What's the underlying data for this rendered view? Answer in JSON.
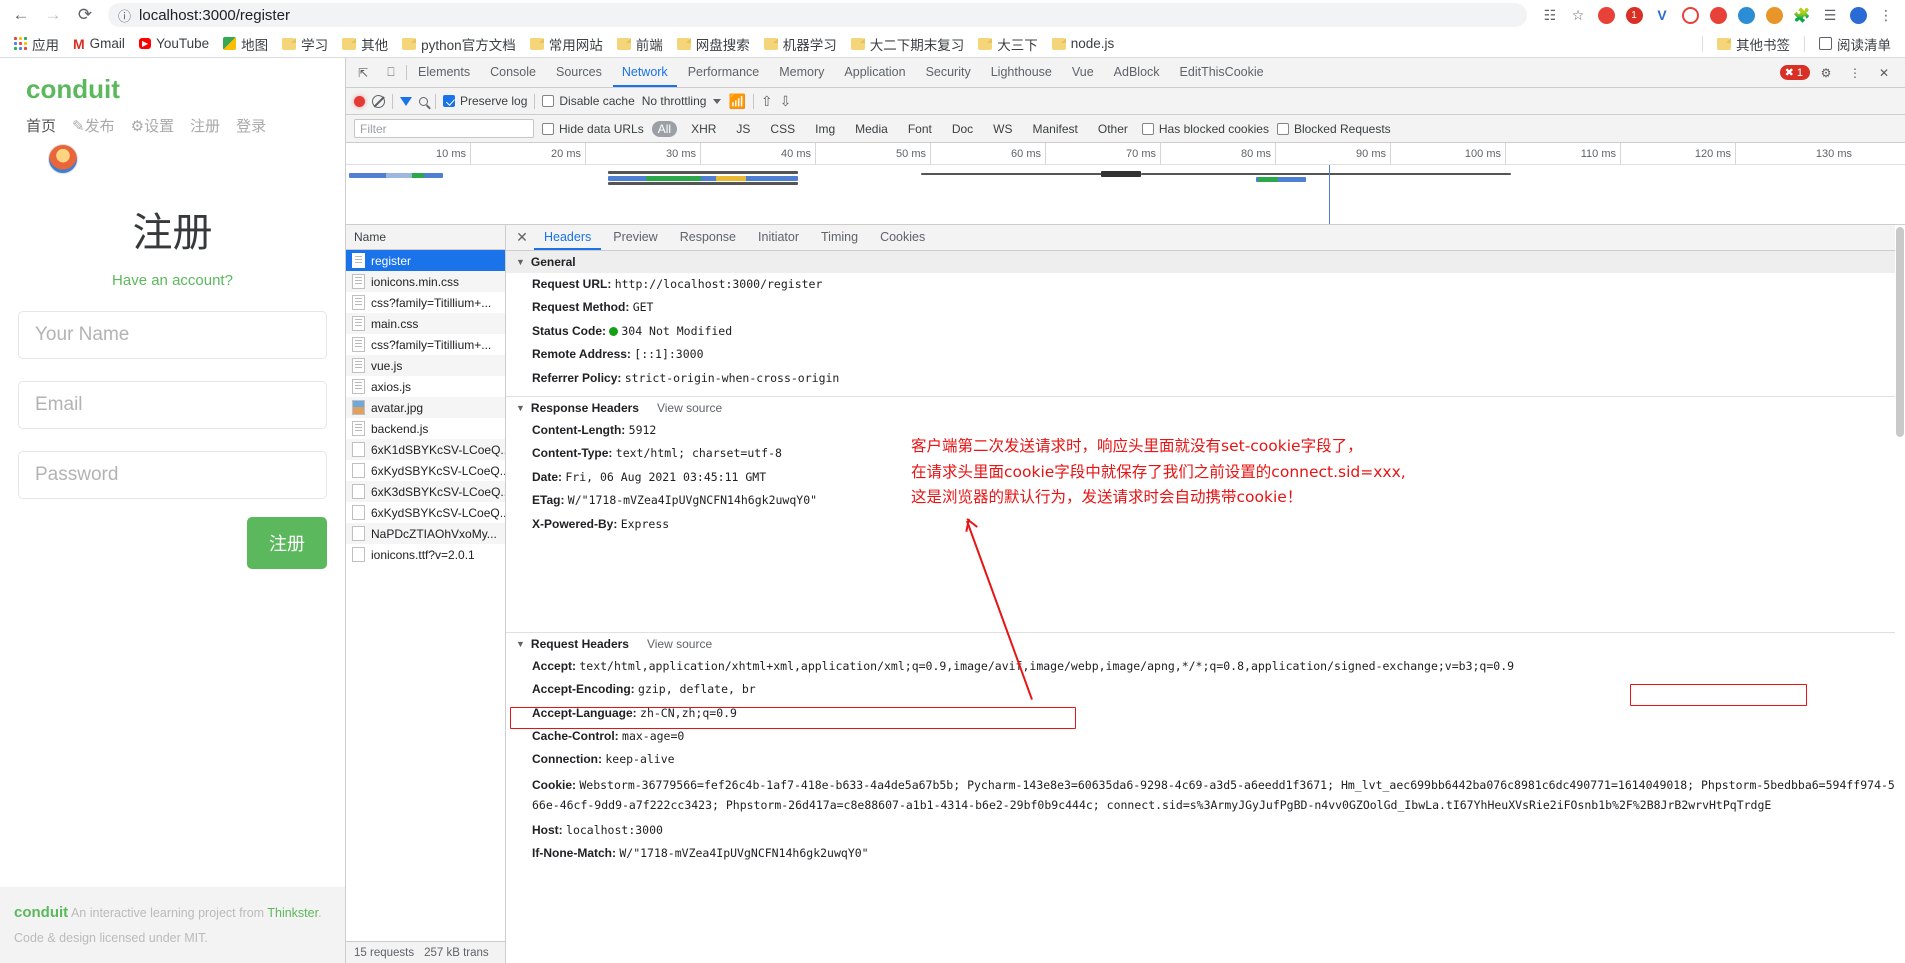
{
  "browser": {
    "back_icon": "←",
    "forward_icon": "→",
    "reload_icon": "⟳",
    "url_scheme_hint": "localhost:3000",
    "url_path": "/register",
    "url_full": "localhost:3000/register",
    "info_icon": "ⓘ",
    "right_icons": [
      {
        "name": "qr-translate-icon",
        "glyph": "🔠"
      },
      {
        "name": "bookmark-star-icon",
        "glyph": "☆"
      },
      {
        "name": "opera-extension-icon",
        "glyph": "O",
        "color": "#e8413a"
      },
      {
        "name": "adblock-extension-icon",
        "glyph": "1",
        "color": "#d93025"
      },
      {
        "name": "vimium-extension-icon",
        "glyph": "V",
        "color": "#2b6cd4"
      },
      {
        "name": "clock-extension-icon",
        "glyph": "◔",
        "color": "#e8413a"
      },
      {
        "name": "grid-extension-icon",
        "glyph": "⁘",
        "color": "#e8413a"
      },
      {
        "name": "blue-extension-icon",
        "glyph": "◉",
        "color": "#2b8ed4"
      },
      {
        "name": "cat-extension-icon",
        "glyph": "◕",
        "color": "#e8962a"
      },
      {
        "name": "puzzle-extensions-icon",
        "glyph": "🧩"
      },
      {
        "name": "list-extension-icon",
        "glyph": "☰"
      },
      {
        "name": "profile-avatar-icon",
        "glyph": "●",
        "color": "#2b6cd4"
      },
      {
        "name": "chrome-menu-icon",
        "glyph": "⋮"
      }
    ]
  },
  "bookmarks": {
    "apps_label": "应用",
    "items": [
      {
        "label": "Gmail",
        "icon": "gmail-icon"
      },
      {
        "label": "YouTube",
        "icon": "youtube-icon"
      },
      {
        "label": "地图",
        "icon": "maps-icon"
      },
      {
        "label": "学习",
        "icon": "folder-icon"
      },
      {
        "label": "其他",
        "icon": "folder-icon"
      },
      {
        "label": "python官方文档",
        "icon": "folder-icon"
      },
      {
        "label": "常用网站",
        "icon": "folder-icon"
      },
      {
        "label": "前端",
        "icon": "folder-icon"
      },
      {
        "label": "网盘搜索",
        "icon": "folder-icon"
      },
      {
        "label": "机器学习",
        "icon": "folder-icon"
      },
      {
        "label": "大二下期末复习",
        "icon": "folder-icon"
      },
      {
        "label": "大三下",
        "icon": "folder-icon"
      },
      {
        "label": "node.js",
        "icon": "folder-icon"
      }
    ],
    "other_bookmarks": "其他书签",
    "reading_list": "阅读清单"
  },
  "conduit": {
    "brand": "conduit",
    "nav": [
      {
        "label": "首页",
        "active": true
      },
      {
        "label": "发布",
        "icon": "compose-icon"
      },
      {
        "label": "设置",
        "icon": "gear-icon"
      },
      {
        "label": "注册"
      },
      {
        "label": "登录"
      }
    ],
    "title": "注册",
    "have_account": "Have an account?",
    "fields": [
      {
        "name": "your-name",
        "placeholder": "Your Name"
      },
      {
        "name": "email",
        "placeholder": "Email"
      },
      {
        "name": "password",
        "placeholder": "Password"
      }
    ],
    "submit_label": "注册",
    "footer": {
      "brand": "conduit",
      "text_before": "An interactive learning project from",
      "link": "Thinkster",
      "text_after": ".",
      "license": "Code & design licensed under MIT."
    }
  },
  "devtools": {
    "left_icons": [
      {
        "name": "inspect-element-icon",
        "glyph": "⇱"
      },
      {
        "name": "device-toolbar-icon",
        "glyph": "▭"
      }
    ],
    "tabs": [
      {
        "label": "Elements",
        "selected": false
      },
      {
        "label": "Console",
        "selected": false
      },
      {
        "label": "Sources",
        "selected": false
      },
      {
        "label": "Network",
        "selected": true
      },
      {
        "label": "Performance",
        "selected": false
      },
      {
        "label": "Memory",
        "selected": false
      },
      {
        "label": "Application",
        "selected": false
      },
      {
        "label": "Security",
        "selected": false
      },
      {
        "label": "Lighthouse",
        "selected": false
      },
      {
        "label": "Vue",
        "selected": false
      },
      {
        "label": "AdBlock",
        "selected": false
      },
      {
        "label": "EditThisCookie",
        "selected": false
      }
    ],
    "error_count": "1",
    "settings_icon": "⚙",
    "more_icon": "⋮",
    "close_icon": "✕",
    "toolbar": {
      "record_title": "record",
      "clear_title": "clear",
      "filter_title": "filter",
      "search_title": "search",
      "preserve_log": "Preserve log",
      "preserve_log_checked": true,
      "disable_cache": "Disable cache",
      "disable_cache_checked": false,
      "throttling": "No throttling",
      "wifi_icon": "wifi-settings-icon",
      "import_icon": "import-har-icon",
      "export_icon": "export-har-icon"
    },
    "filterbar": {
      "filter_placeholder": "Filter",
      "hide_data_urls": "Hide data URLs",
      "types": [
        "All",
        "XHR",
        "JS",
        "CSS",
        "Img",
        "Media",
        "Font",
        "Doc",
        "WS",
        "Manifest",
        "Other"
      ],
      "selected_type": "All",
      "has_blocked_cookies": "Has blocked cookies",
      "blocked_requests": "Blocked Requests"
    },
    "overview_ticks": [
      "10 ms",
      "20 ms",
      "30 ms",
      "40 ms",
      "50 ms",
      "60 ms",
      "70 ms",
      "80 ms",
      "90 ms",
      "100 ms",
      "110 ms",
      "120 ms",
      "130 ms"
    ],
    "name_column_header": "Name",
    "requests": [
      {
        "name": "register",
        "icon": "doc",
        "selected": true
      },
      {
        "name": "ionicons.min.css",
        "icon": "doc"
      },
      {
        "name": "css?family=Titillium+...",
        "icon": "doc"
      },
      {
        "name": "main.css",
        "icon": "doc"
      },
      {
        "name": "css?family=Titillium+...",
        "icon": "doc"
      },
      {
        "name": "vue.js",
        "icon": "doc"
      },
      {
        "name": "axios.js",
        "icon": "doc"
      },
      {
        "name": "avatar.jpg",
        "icon": "img"
      },
      {
        "name": "backend.js",
        "icon": "doc"
      },
      {
        "name": "6xK1dSBYKcSV-LCoeQ...",
        "icon": "blank"
      },
      {
        "name": "6xKydSBYKcSV-LCoeQ...",
        "icon": "blank"
      },
      {
        "name": "6xK3dSBYKcSV-LCoeQ...",
        "icon": "blank"
      },
      {
        "name": "6xKydSBYKcSV-LCoeQ...",
        "icon": "blank"
      },
      {
        "name": "NaPDcZTIAOhVxoMy...",
        "icon": "blank"
      },
      {
        "name": "ionicons.ttf?v=2.0.1",
        "icon": "blank"
      }
    ],
    "footer_status": [
      "15 requests",
      "257 kB trans"
    ],
    "detail_tabs": [
      {
        "label": "Headers",
        "selected": true
      },
      {
        "label": "Preview",
        "selected": false
      },
      {
        "label": "Response",
        "selected": false
      },
      {
        "label": "Initiator",
        "selected": false
      },
      {
        "label": "Timing",
        "selected": false
      },
      {
        "label": "Cookies",
        "selected": false
      }
    ],
    "sections": {
      "general_title": "General",
      "general": [
        {
          "key": "Request URL:",
          "value": "http://localhost:3000/register"
        },
        {
          "key": "Request Method:",
          "value": "GET"
        },
        {
          "key": "Status Code:",
          "value": "304 Not Modified",
          "dot": true
        },
        {
          "key": "Remote Address:",
          "value": "[::1]:3000"
        },
        {
          "key": "Referrer Policy:",
          "value": "strict-origin-when-cross-origin"
        }
      ],
      "response_title": "Response Headers",
      "view_source": "View source",
      "response": [
        {
          "key": "Content-Length:",
          "value": "5912"
        },
        {
          "key": "Content-Type:",
          "value": "text/html; charset=utf-8"
        },
        {
          "key": "Date:",
          "value": "Fri, 06 Aug 2021 03:45:11 GMT"
        },
        {
          "key": "ETag:",
          "value": "W/\"1718-mVZea4IpUVgNCFN14h6gk2uwqY0\""
        },
        {
          "key": "X-Powered-By:",
          "value": "Express"
        }
      ],
      "request_title": "Request Headers",
      "request": [
        {
          "key": "Accept:",
          "value": "text/html,application/xhtml+xml,application/xml;q=0.9,image/avif,image/webp,image/apng,*/*;q=0.8,application/signed-exchange;v=b3;q=0.9"
        },
        {
          "key": "Accept-Encoding:",
          "value": "gzip, deflate, br"
        },
        {
          "key": "Accept-Language:",
          "value": "zh-CN,zh;q=0.9"
        },
        {
          "key": "Cache-Control:",
          "value": "max-age=0"
        },
        {
          "key": "Connection:",
          "value": "keep-alive"
        },
        {
          "key": "Cookie:",
          "value": "Webstorm-36779566=fef26c4b-1af7-418e-b633-4a4de5a67b5b; Pycharm-143e8e3=60635da6-9298-4c69-a3d5-a6eedd1f3671; Hm_lvt_aec699bb6442ba076c8981c6dc490771=1614049018; Phpstorm-5bedbba6=594ff974-566e-46cf-9dd9-a7f222cc3423; Phpstorm-26d417a=c8e88607-a1b1-4314-b6e2-29bf0b9c444c; connect.sid=s%3ArmyJGyJufPgBD-n4vv0GZOolGd_IbwLa.tI67YhHeuXVsRie2iFOsnb1b%2F%2B8JrB2wrvHtPqTrdgE"
        },
        {
          "key": "Host:",
          "value": "localhost:3000"
        },
        {
          "key": "If-None-Match:",
          "value": "W/\"1718-mVZea4IpUVgNCFN14h6gk2uwqY0\""
        }
      ]
    },
    "annotation": {
      "line1": "客户端第二次发送请求时，响应头里面就没有set-cookie字段了，",
      "line2": "在请求头里面cookie字段中就保存了我们之前设置的connect.sid=xxx,",
      "line3": "这是浏览器的默认行为，发送请求时会自动携带cookie！",
      "color": "#e81313"
    }
  }
}
